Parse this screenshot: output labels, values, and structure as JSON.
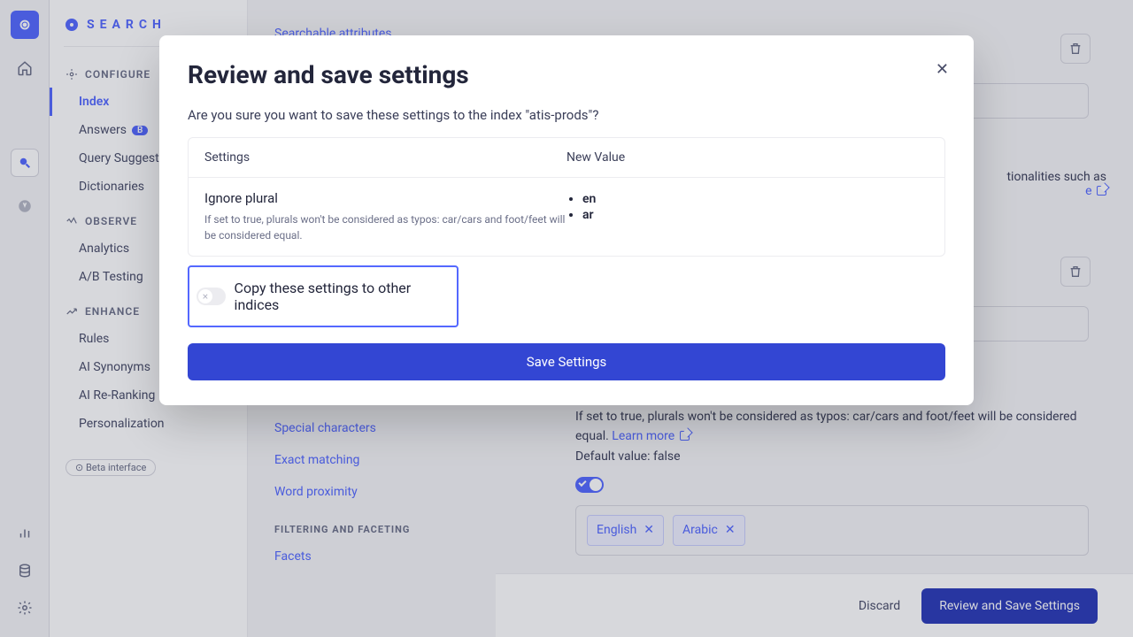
{
  "sidebar": {
    "search_label": "SEARCH",
    "sections": {
      "configure": {
        "title": "CONFIGURE",
        "items": [
          "Index",
          "Answers",
          "Query Suggestions",
          "Dictionaries"
        ],
        "active": 0,
        "badge_on": 1,
        "badge": "B"
      },
      "observe": {
        "title": "OBSERVE",
        "items": [
          "Analytics",
          "A/B Testing"
        ]
      },
      "enhance": {
        "title": "ENHANCE",
        "items": [
          "Rules",
          "AI Synonyms",
          "AI Re-Ranking",
          "Personalization"
        ]
      }
    },
    "beta_pill": "⊙ Beta interface"
  },
  "subnav": {
    "top_link": "Searchable attributes",
    "links": [
      "Special characters",
      "Exact matching",
      "Word proximity"
    ],
    "group": "FILTERING AND FACETING",
    "bottom": "Facets"
  },
  "content": {
    "truncated_right": "tionalities such as",
    "learn_link_trunc": "e",
    "desc_line1": "If set to true, plurals won't be considered as typos: car/cars and foot/feet will be considered equal.",
    "learn_more": "Learn more",
    "default_value": "Default value: false",
    "chips": [
      "English",
      "Arabic"
    ]
  },
  "footer": {
    "discard": "Discard",
    "save": "Review and Save Settings"
  },
  "modal": {
    "title": "Review and save settings",
    "confirm": "Are you sure you want to save these settings to the index \"atis-prods\"?",
    "col1": "Settings",
    "col2": "New Value",
    "setting_name": "Ignore plural",
    "setting_desc": "If set to true, plurals won't be considered as typos: car/cars and foot/feet will be considered equal.",
    "values": [
      "en",
      "ar"
    ],
    "copy_label": "Copy these settings to other indices",
    "save_btn": "Save Settings"
  }
}
